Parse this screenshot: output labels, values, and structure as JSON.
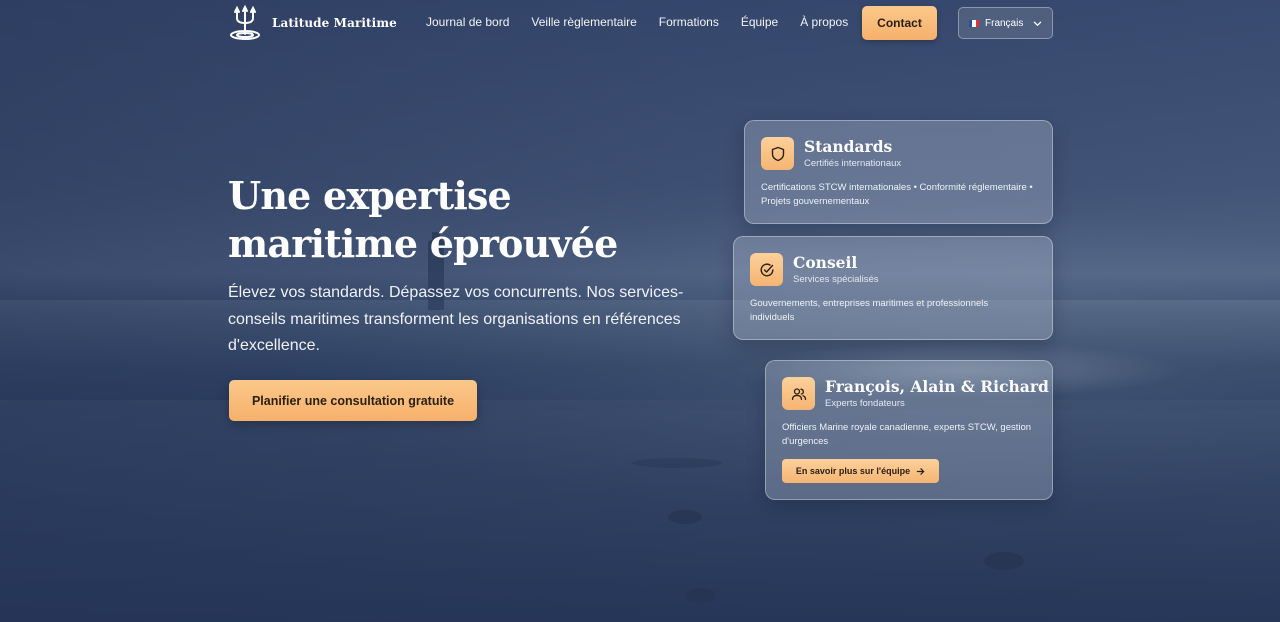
{
  "brand": {
    "name": "Latitude Maritime"
  },
  "nav": {
    "links": [
      "Journal de bord",
      "Veille règlementaire",
      "Formations",
      "Équipe",
      "À propos"
    ],
    "contact_label": "Contact",
    "language": "Français"
  },
  "hero": {
    "title": "Une expertise maritime éprouvée",
    "subtitle": "Élevez vos standards. Dépassez vos concurrents. Nos services-conseils maritimes transforment les organisations en références d'excellence.",
    "cta_label": "Planifier une consultation gratuite"
  },
  "cards": [
    {
      "icon": "shield-icon",
      "title": "Standards",
      "subtitle": "Certifiés internationaux",
      "body": "Certifications STCW internationales • Conformité réglementaire • Projets gouvernementaux"
    },
    {
      "icon": "check-circle-icon",
      "title": "Conseil",
      "subtitle": "Services spécialisés",
      "body": "Gouvernements, entreprises maritimes et professionnels individuels"
    },
    {
      "icon": "users-icon",
      "title": "François, Alain & Richard",
      "subtitle": "Experts fondateurs",
      "body": "Officiers Marine royale canadienne, experts STCW, gestion d'urgences",
      "button_label": "En savoir plus sur l'équipe"
    }
  ],
  "colors": {
    "accent": "#f7b774",
    "accent_text": "#2b2013",
    "background": "#2f4368"
  }
}
